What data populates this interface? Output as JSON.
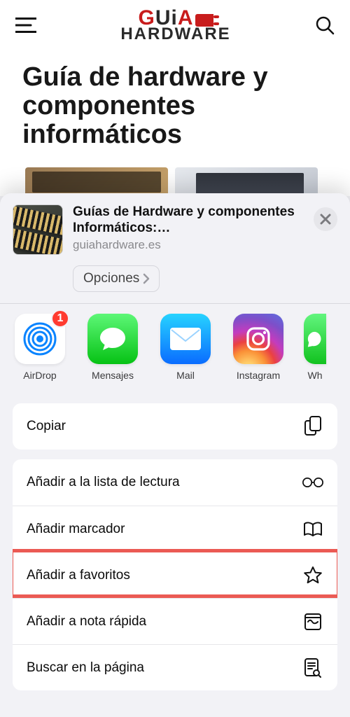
{
  "page": {
    "logo_top": "GUiA",
    "logo_bottom": "HARDWARE",
    "title": "Guía de hardware y componentes informáticos"
  },
  "sheet": {
    "title": "Guías de Hardware y componentes Informáticos:…",
    "url": "guiahardware.es",
    "options_label": "Opciones",
    "apps": [
      {
        "label": "AirDrop",
        "badge": "1"
      },
      {
        "label": "Mensajes"
      },
      {
        "label": "Mail"
      },
      {
        "label": "Instagram"
      },
      {
        "label": "Wh"
      }
    ],
    "actions": [
      {
        "label": "Copiar"
      },
      {
        "label": "Añadir a la lista de lectura"
      },
      {
        "label": "Añadir marcador"
      },
      {
        "label": "Añadir a favoritos",
        "highlight": true
      },
      {
        "label": "Añadir a nota rápida"
      },
      {
        "label": "Buscar en la página"
      }
    ]
  }
}
